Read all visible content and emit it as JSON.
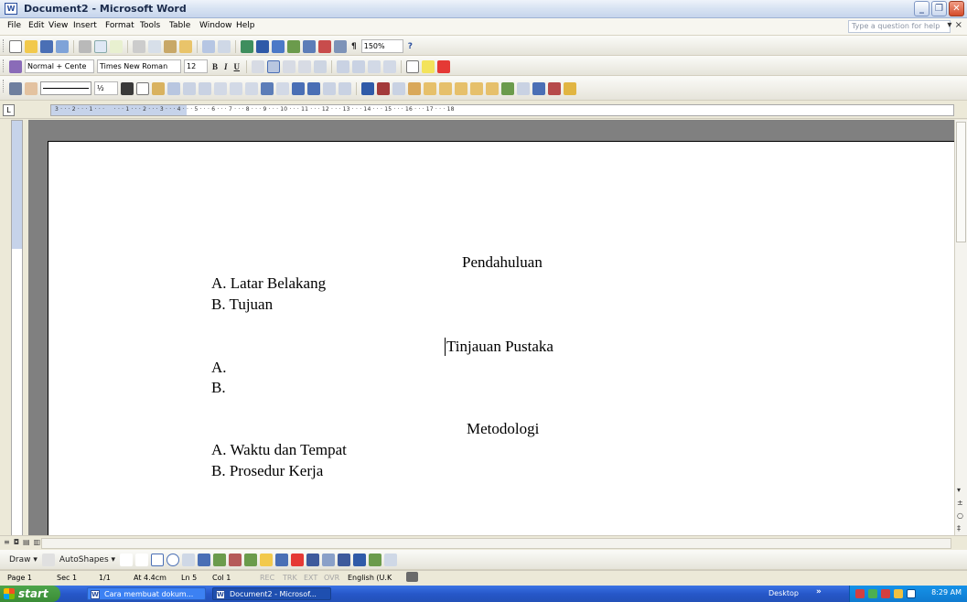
{
  "window": {
    "title": "Document2 - Microsoft Word",
    "icon_letter": "W",
    "minimize": "_",
    "restore": "❐",
    "close": "✕"
  },
  "menu": {
    "items": [
      "File",
      "Edit",
      "View",
      "Insert",
      "Format",
      "Tools",
      "Table",
      "Window",
      "Help"
    ],
    "help_placeholder": "Type a question for help",
    "close_doc": "▾ ×"
  },
  "standard_toolbar": {
    "zoom": "150%",
    "help_icon": "?"
  },
  "formatting_toolbar": {
    "style": "Normal + Cente",
    "font": "Times New Roman",
    "size": "12",
    "bold": "B",
    "italic": "I",
    "underline": "U"
  },
  "tables_toolbar": {
    "line_weight": "½"
  },
  "ruler": {
    "numbers": "3 · · · 2 · · · 1 · · ·     · · · 1 · · · 2 · · · 3 · · · 4 · · · 5 · · · 6 · · · 7 · · · 8 · · · 9 · · · 10 · · · 11 · · · 12 · · · 13 · · · 14 · · · 15 · · · 16 · · · 17 · · · 18"
  },
  "document": {
    "sections": [
      {
        "heading": "Pendahuluan",
        "items": [
          "A.  Latar Belakang",
          "B.  Tujuan"
        ]
      },
      {
        "heading": "Tinjauan Pustaka",
        "items": [
          "A.",
          "B."
        ]
      },
      {
        "heading": "Metodologi",
        "items": [
          "A.  Waktu dan Tempat",
          "B.  Prosedur Kerja"
        ]
      }
    ]
  },
  "drawing_toolbar": {
    "draw": "Draw ▾",
    "autoshapes": "AutoShapes ▾"
  },
  "status": {
    "page": "Page 1",
    "sec": "Sec 1",
    "pages": "1/1",
    "at": "At 4.4cm",
    "ln": "Ln 5",
    "col": "Col 1",
    "rec": "REC",
    "trk": "TRK",
    "ext": "EXT",
    "ovr": "OVR",
    "lang": "English (U.K"
  },
  "taskbar": {
    "start": "start",
    "tasks": [
      "Cara membuat dokum...",
      "Document2 - Microsof..."
    ],
    "desktop": "Desktop",
    "clock": "8:29 AM"
  }
}
